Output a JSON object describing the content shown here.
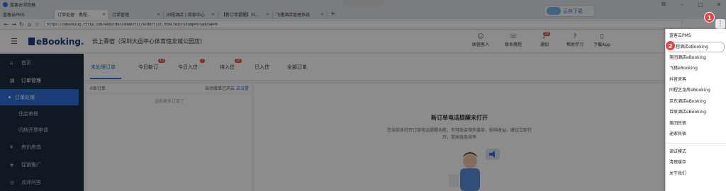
{
  "browser": {
    "title": "蓝客云浏览器",
    "tabs": [
      {
        "label": "蓝客云PMS"
      },
      {
        "label": "订单处理 · 携程..."
      },
      {
        "label": "订单管理"
      },
      {
        "label": "同程酒店 | 商家中心"
      },
      {
        "label": "【新订单提醒】抖..."
      },
      {
        "label": "飞猪酒店管理系统"
      }
    ],
    "new_tab": "+",
    "url": "https://ebooking.ctrip.com/ebkorder/domestic/orderlist.html?microJump=true&tab=0",
    "cloud_download": "云存下载",
    "kebab": "⋮"
  },
  "header": {
    "brand": "eBooking.",
    "hotel_name": "云上青宿（深圳大运中心体育馆龙城公园店）",
    "actions": [
      {
        "label": "国营客人",
        "icon": "person-icon",
        "badge": ""
      },
      {
        "label": "联系携程",
        "icon": "chat-icon",
        "badge": ""
      },
      {
        "label": "通知",
        "icon": "bell-icon",
        "badge": "28"
      },
      {
        "label": "帮助学习",
        "icon": "help-icon",
        "badge": ""
      },
      {
        "label": "下载App",
        "icon": "phone-icon",
        "badge": ""
      }
    ]
  },
  "sidebar": {
    "items": [
      {
        "label": "首页",
        "icon": "home-icon"
      },
      {
        "label": "订单管理",
        "icon": "order-icon"
      },
      {
        "label": "订单处理",
        "active": true
      },
      {
        "label": "住店审核"
      },
      {
        "label": "归档开票申请"
      },
      {
        "label": "房价房态",
        "icon": "price-icon"
      },
      {
        "label": "促销推广",
        "icon": "promo-icon"
      },
      {
        "label": "点评问答",
        "icon": "review-icon"
      }
    ]
  },
  "order_tabs": [
    {
      "label": "未处理订单",
      "badge": "",
      "active": true
    },
    {
      "label": "今日新订",
      "badge": "10"
    },
    {
      "label": "今日入住",
      "badge": "7"
    },
    {
      "label": "待入住",
      "badge": "15"
    },
    {
      "label": "已入住",
      "badge": ""
    },
    {
      "label": "全部订单",
      "badge": ""
    }
  ],
  "order_list": {
    "count": "0条订单",
    "auto_accept": "自动接单已开启",
    "settings_link": "去设置",
    "empty": "没能更多订单了"
  },
  "detail": {
    "title": "新订单电话提醒未打开",
    "description": "您当前未打开订单电话提醒功能，有可能会错失接单，影响收益。建议立即打开，提高接单效率"
  },
  "menu": {
    "items": [
      "蓝客云PMS",
      "携程酒店eBooking",
      "美团酒店eBooking",
      "飞猪eBooking",
      "抖音来客",
      "同程艺龙房eBooking",
      "京东酒店eBooking",
      "百联酒店eBooking",
      "美团民宿",
      "途家民宿"
    ],
    "items2": [
      "调试模式",
      "清理缓存",
      "关于我们"
    ],
    "selected_index": 1
  },
  "markers": [
    "1",
    "2"
  ]
}
